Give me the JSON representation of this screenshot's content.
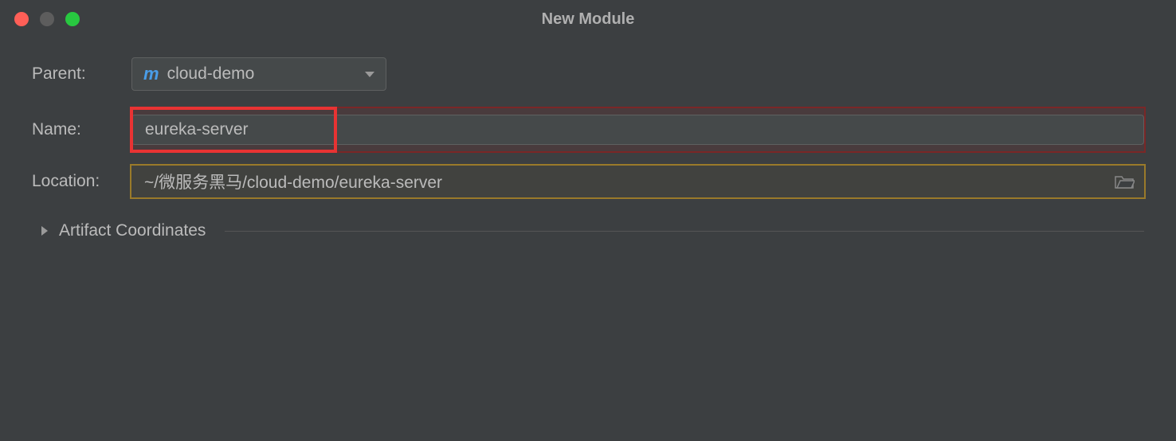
{
  "window": {
    "title": "New Module"
  },
  "form": {
    "parent": {
      "label": "Parent:",
      "icon_glyph": "m",
      "value": "cloud-demo"
    },
    "name": {
      "label": "Name:",
      "value": "eureka-server"
    },
    "location": {
      "label": "Location:",
      "value": "~/微服务黑马/cloud-demo/eureka-server"
    },
    "artifact": {
      "label": "Artifact Coordinates"
    }
  }
}
